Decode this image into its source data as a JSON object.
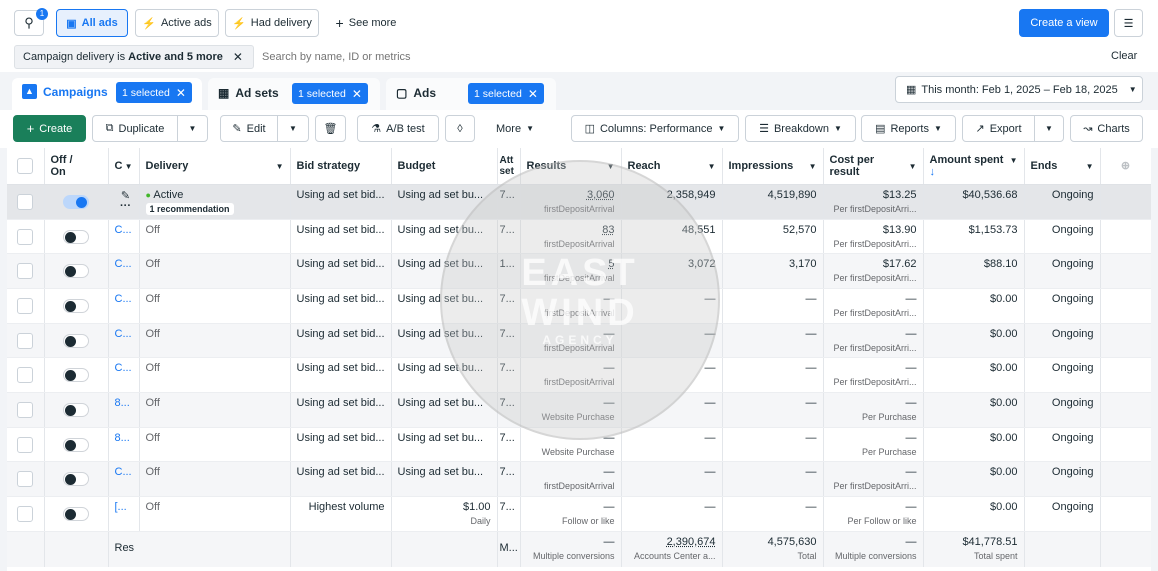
{
  "top": {
    "search_badge": "1",
    "all_ads": "All ads",
    "active_ads": "Active ads",
    "had_delivery": "Had delivery",
    "see_more": "See more",
    "create_view": "Create a view"
  },
  "filter": {
    "chip_prefix": "Campaign delivery is ",
    "chip_value": "Active and 5 more",
    "search_placeholder": "Search by name, ID or metrics",
    "clear": "Clear"
  },
  "tabs": {
    "campaigns": "Campaigns",
    "campaigns_sel": "1 selected",
    "adsets": "Ad sets",
    "adsets_sel": "1 selected",
    "ads": "Ads",
    "ads_sel": "1 selected",
    "date_range": "This month: Feb 1, 2025 – Feb 18, 2025"
  },
  "toolbar": {
    "create": "Create",
    "duplicate": "Duplicate",
    "edit": "Edit",
    "ab_test": "A/B test",
    "more": "More",
    "columns": "Columns: Performance",
    "breakdown": "Breakdown",
    "reports": "Reports",
    "export": "Export",
    "charts": "Charts"
  },
  "table": {
    "headers": {
      "onoff": "Off / On",
      "name": "C",
      "delivery": "Delivery",
      "bid": "Bid strategy",
      "budget": "Budget",
      "attr": "Att set",
      "results": "Results",
      "reach": "Reach",
      "impressions": "Impressions",
      "cost": "Cost per result",
      "spent": "Amount spent",
      "ends": "Ends"
    },
    "rows": [
      {
        "name": "",
        "delivery": "Active",
        "rec": "1 recommendation",
        "bid": "Using ad set bid...",
        "budget": "Using ad set bu...",
        "budget_sub": "",
        "attr": "7...",
        "results": "3,060",
        "results_sub": "firstDepositArrival",
        "reach": "2,358,949",
        "impr": "4,519,890",
        "cost": "$13.25",
        "cost_sub": "Per firstDepositArri...",
        "spent": "$40,536.68",
        "ends": "Ongoing"
      },
      {
        "name": "C...",
        "delivery": "Off",
        "rec": "",
        "bid": "Using ad set bid...",
        "budget": "Using ad set bu...",
        "budget_sub": "",
        "attr": "7...",
        "results": "83",
        "results_sub": "firstDepositArrival",
        "reach": "48,551",
        "impr": "52,570",
        "cost": "$13.90",
        "cost_sub": "Per firstDepositArri...",
        "spent": "$1,153.73",
        "ends": "Ongoing"
      },
      {
        "name": "C...",
        "delivery": "Off",
        "rec": "",
        "bid": "Using ad set bid...",
        "budget": "Using ad set bu...",
        "budget_sub": "",
        "attr": "1...",
        "results": "5",
        "results_sub": "firstDepositArrival",
        "reach": "3,072",
        "impr": "3,170",
        "cost": "$17.62",
        "cost_sub": "Per firstDepositArri...",
        "spent": "$88.10",
        "ends": "Ongoing"
      },
      {
        "name": "C...",
        "delivery": "Off",
        "rec": "",
        "bid": "Using ad set bid...",
        "budget": "Using ad set bu...",
        "budget_sub": "",
        "attr": "7...",
        "results": "—",
        "results_sub": "firstDepositArrival",
        "reach": "—",
        "impr": "—",
        "cost": "—",
        "cost_sub": "Per firstDepositArri...",
        "spent": "$0.00",
        "ends": "Ongoing"
      },
      {
        "name": "C...",
        "delivery": "Off",
        "rec": "",
        "bid": "Using ad set bid...",
        "budget": "Using ad set bu...",
        "budget_sub": "",
        "attr": "7...",
        "results": "—",
        "results_sub": "firstDepositArrival",
        "reach": "—",
        "impr": "—",
        "cost": "—",
        "cost_sub": "Per firstDepositArri...",
        "spent": "$0.00",
        "ends": "Ongoing"
      },
      {
        "name": "C...",
        "delivery": "Off",
        "rec": "",
        "bid": "Using ad set bid...",
        "budget": "Using ad set bu...",
        "budget_sub": "",
        "attr": "7...",
        "results": "—",
        "results_sub": "firstDepositArrival",
        "reach": "—",
        "impr": "—",
        "cost": "—",
        "cost_sub": "Per firstDepositArri...",
        "spent": "$0.00",
        "ends": "Ongoing"
      },
      {
        "name": "8...",
        "delivery": "Off",
        "rec": "",
        "bid": "Using ad set bid...",
        "budget": "Using ad set bu...",
        "budget_sub": "",
        "attr": "7...",
        "results": "—",
        "results_sub": "Website Purchase",
        "reach": "—",
        "impr": "—",
        "cost": "—",
        "cost_sub": "Per Purchase",
        "spent": "$0.00",
        "ends": "Ongoing"
      },
      {
        "name": "8...",
        "delivery": "Off",
        "rec": "",
        "bid": "Using ad set bid...",
        "budget": "Using ad set bu...",
        "budget_sub": "",
        "attr": "7...",
        "results": "—",
        "results_sub": "Website Purchase",
        "reach": "—",
        "impr": "—",
        "cost": "—",
        "cost_sub": "Per Purchase",
        "spent": "$0.00",
        "ends": "Ongoing"
      },
      {
        "name": "C...",
        "delivery": "Off",
        "rec": "",
        "bid": "Using ad set bid...",
        "budget": "Using ad set bu...",
        "budget_sub": "",
        "attr": "7...",
        "results": "—",
        "results_sub": "firstDepositArrival",
        "reach": "—",
        "impr": "—",
        "cost": "—",
        "cost_sub": "Per firstDepositArri...",
        "spent": "$0.00",
        "ends": "Ongoing"
      },
      {
        "name": "[...",
        "delivery": "Off",
        "rec": "",
        "bid": "Highest volume",
        "budget": "$1.00",
        "budget_sub": "Daily",
        "attr": "7...",
        "results": "—",
        "results_sub": "Follow or like",
        "reach": "—",
        "impr": "—",
        "cost": "—",
        "cost_sub": "Per Follow or like",
        "spent": "$0.00",
        "ends": "Ongoing"
      }
    ],
    "footer": {
      "label": "Res",
      "attr": "M...",
      "results": "—",
      "results_sub": "Multiple conversions",
      "reach": "2,390,674",
      "reach_sub": "Accounts Center a...",
      "impr": "4,575,630",
      "impr_sub": "Total",
      "cost": "—",
      "cost_sub": "Multiple conversions",
      "spent": "$41,778.51",
      "spent_sub": "Total spent"
    }
  },
  "watermark": {
    "line1": "EAST",
    "line2": "WIND",
    "line3": "AGENCY"
  }
}
